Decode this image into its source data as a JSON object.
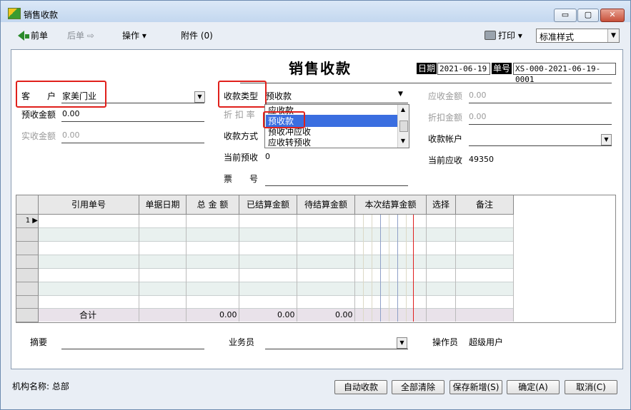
{
  "window": {
    "title": "销售收款",
    "min_label": "▭",
    "max_label": "▢",
    "close_label": "✕"
  },
  "toolbar": {
    "prev_label": "前单",
    "next_label": "后单",
    "next_arrow": "⇨",
    "ops_label": "操作",
    "ops_caret": "▾",
    "attach_label": "附件 (0)",
    "print_label": "打印",
    "print_caret": "▾",
    "style_value": "标准样式"
  },
  "form": {
    "title": "销售收款",
    "date_tag": "日期",
    "date_value": "2021-06-19",
    "no_tag": "单号",
    "no_value": "XS-000-2021-06-19-0001",
    "customer_label": "客　　户",
    "customer_value": "家美门业",
    "prepay_amount_label": "预收金额",
    "prepay_amount_value": "0.00",
    "actual_amount_label": "实收金额",
    "actual_amount_value": "0.00",
    "receipt_type_label": "收款类型",
    "receipt_type_value": "预收款",
    "discount_rate_label": "折 扣 率",
    "receipt_method_label": "收款方式",
    "current_prepay_label": "当前预收",
    "current_prepay_value": "0",
    "ticket_label": "票　　号",
    "receivable_label": "应收金额",
    "receivable_value": "0.00",
    "discount_amount_label": "折扣金额",
    "discount_amount_value": "0.00",
    "account_label": "收款帐户",
    "current_receivable_label": "当前应收",
    "current_receivable_value": "49350"
  },
  "dropdown": {
    "options": [
      "应收款",
      "预收款",
      "预收冲应收",
      "应收转预收"
    ],
    "selected": "预收款"
  },
  "grid": {
    "columns": [
      "引用单号",
      "单据日期",
      "总 金 额",
      "已结算金额",
      "待结算金额",
      "本次结算金额",
      "选择",
      "备注"
    ],
    "row_number": "1",
    "total_label": "合计",
    "totals": [
      "0.00",
      "0.00",
      "0.00"
    ]
  },
  "bottom": {
    "summary_label": "摘要",
    "salesman_label": "业务员",
    "operator_label": "操作员",
    "operator_value": "超级用户"
  },
  "footer": {
    "org_label": "机构名称: 总部",
    "buttons": [
      "自动收款",
      "全部清除",
      "保存新增(S)",
      "确定(A)",
      "取消(C)"
    ]
  }
}
